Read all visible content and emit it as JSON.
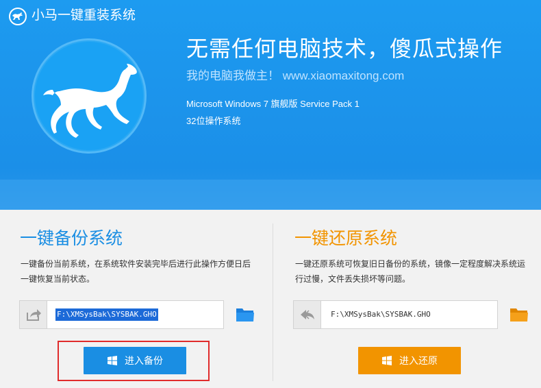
{
  "app": {
    "title": "小马一键重装系统"
  },
  "hero": {
    "headline": "无需任何电脑技术，傻瓜式操作",
    "subline": "我的电脑我做主！ www.xiaomaxitong.com",
    "os_name": "Microsoft Windows 7 旗舰版 Service Pack 1",
    "os_arch": "32位操作系统"
  },
  "backup": {
    "title": "一键备份系统",
    "description": "一键备份当前系统，在系统软件安装完毕后进行此操作方便日后一键恢复当前状态。",
    "path": "F:\\XMSysBak\\SYSBAK.GHO",
    "button_label": "进入备份"
  },
  "restore": {
    "title": "一键还原系统",
    "description": "一键还原系统可恢复旧日备份的系统，镜像一定程度解决系统运行过慢，文件丢失损坏等问题。",
    "path": "F:\\XMSysBak\\SYSBAK.GHO",
    "button_label": "进入还原"
  },
  "colors": {
    "brand_blue": "#1d9bf0",
    "backup_accent": "#1a8ee3",
    "restore_accent": "#f29400",
    "highlight_red": "#e02b2b"
  }
}
